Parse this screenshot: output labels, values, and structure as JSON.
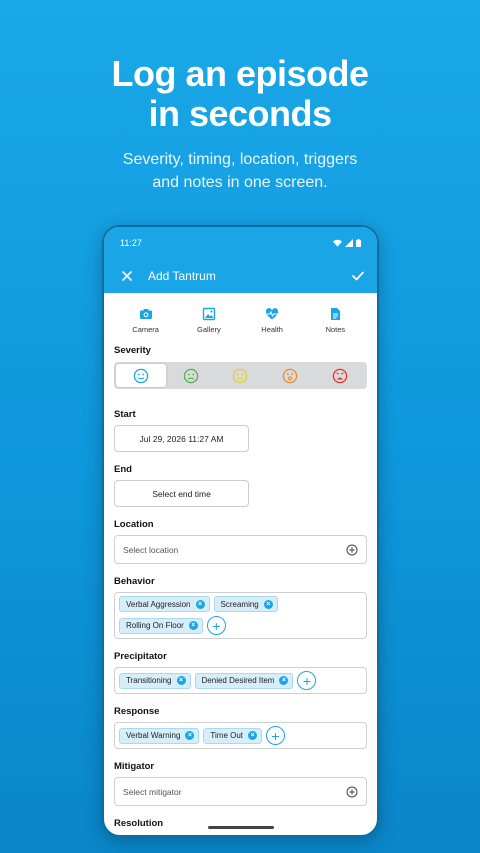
{
  "promo": {
    "headline_line1": "Log an episode",
    "headline_line2": "in seconds",
    "sub_line1": "Severity, timing, location, triggers",
    "sub_line2": "and notes in one screen."
  },
  "status_bar": {
    "time": "11:27"
  },
  "app_bar": {
    "title": "Add Tantrum",
    "close_icon": "close-icon",
    "confirm_icon": "check-icon"
  },
  "attachments": [
    {
      "label": "Camera",
      "icon": "camera-icon"
    },
    {
      "label": "Gallery",
      "icon": "gallery-icon"
    },
    {
      "label": "Health",
      "icon": "health-icon"
    },
    {
      "label": "Notes",
      "icon": "notes-icon"
    }
  ],
  "severity": {
    "label": "Severity",
    "selected_index": 0,
    "levels": [
      {
        "icon": "face-neutral-icon",
        "color": "#1aa6e6"
      },
      {
        "icon": "face-sad-icon",
        "color": "#55b047"
      },
      {
        "icon": "face-upset-icon",
        "color": "#e2cf2a"
      },
      {
        "icon": "face-distressed-icon",
        "color": "#f08a24"
      },
      {
        "icon": "face-angry-icon",
        "color": "#e5322d"
      }
    ]
  },
  "start": {
    "label": "Start",
    "value": "Jul 29, 2026 11:27 AM"
  },
  "end": {
    "label": "End",
    "value": "Select end time"
  },
  "location": {
    "label": "Location",
    "placeholder": "Select location"
  },
  "behavior": {
    "label": "Behavior",
    "chips": [
      "Verbal Aggression",
      "Screaming",
      "Rolling On Floor"
    ]
  },
  "precipitator": {
    "label": "Precipitator",
    "chips": [
      "Transitioning",
      "Denied Desired Item"
    ]
  },
  "response": {
    "label": "Response",
    "chips": [
      "Verbal Warning",
      "Time Out"
    ]
  },
  "mitigator": {
    "label": "Mitigator",
    "placeholder": "Select mitigator"
  },
  "resolution": {
    "label": "Resolution"
  },
  "colors": {
    "accent": "#1aa6e6",
    "background": "#1aa8e8"
  }
}
